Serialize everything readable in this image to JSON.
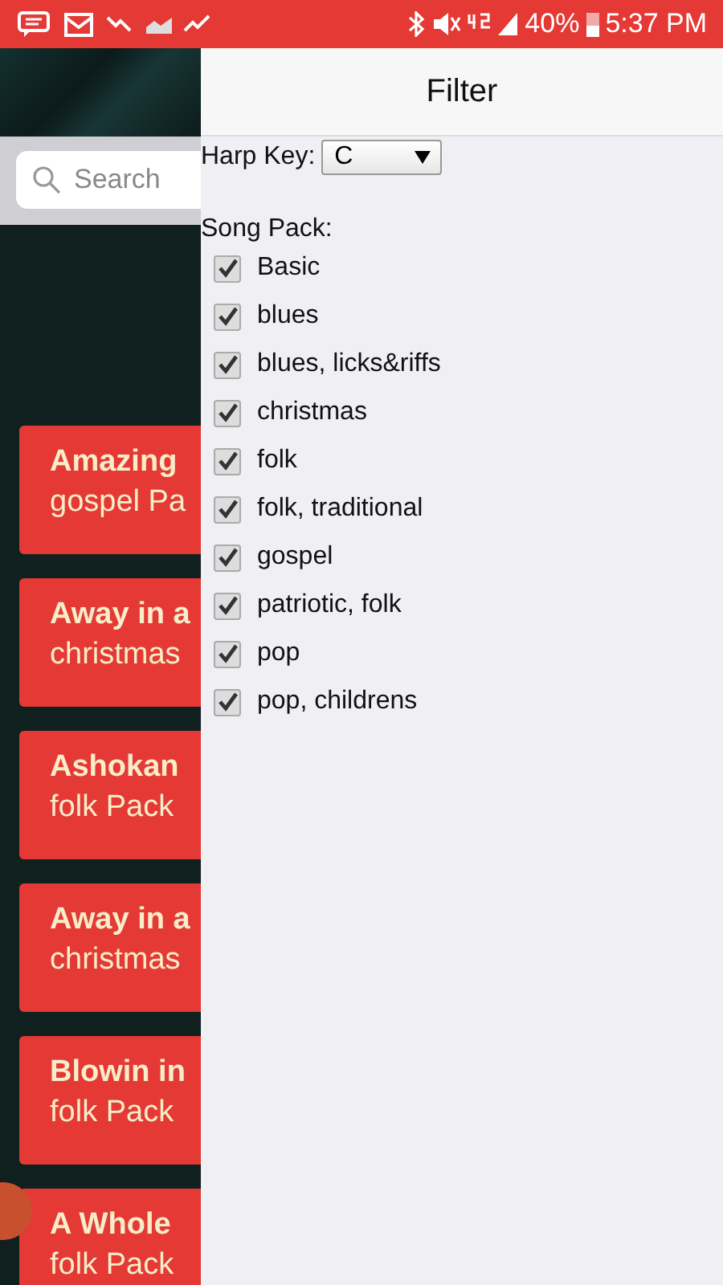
{
  "status_bar": {
    "battery": "40%",
    "time": "5:37 PM"
  },
  "search": {
    "placeholder": "Search"
  },
  "songs": [
    {
      "title": "Amazing",
      "pack": "gospel Pa"
    },
    {
      "title": "Away in a",
      "pack": "christmas"
    },
    {
      "title": "Ashokan",
      "pack": "folk Pack"
    },
    {
      "title": "Away in a",
      "pack": "christmas"
    },
    {
      "title": "Blowin in",
      "pack": "folk Pack"
    },
    {
      "title": "A Whole",
      "pack": "folk Pack"
    }
  ],
  "filter": {
    "title": "Filter",
    "harp_key_label": "Harp Key:",
    "harp_key": "C",
    "song_pack_label": "Song Pack:",
    "packs": [
      {
        "label": "Basic",
        "checked": true
      },
      {
        "label": "blues",
        "checked": true
      },
      {
        "label": "blues, licks&riffs",
        "checked": true
      },
      {
        "label": "christmas",
        "checked": true
      },
      {
        "label": "folk",
        "checked": true
      },
      {
        "label": "folk, traditional",
        "checked": true
      },
      {
        "label": "gospel",
        "checked": true
      },
      {
        "label": "patriotic, folk",
        "checked": true
      },
      {
        "label": "pop",
        "checked": true
      },
      {
        "label": "pop, childrens",
        "checked": true
      }
    ]
  }
}
